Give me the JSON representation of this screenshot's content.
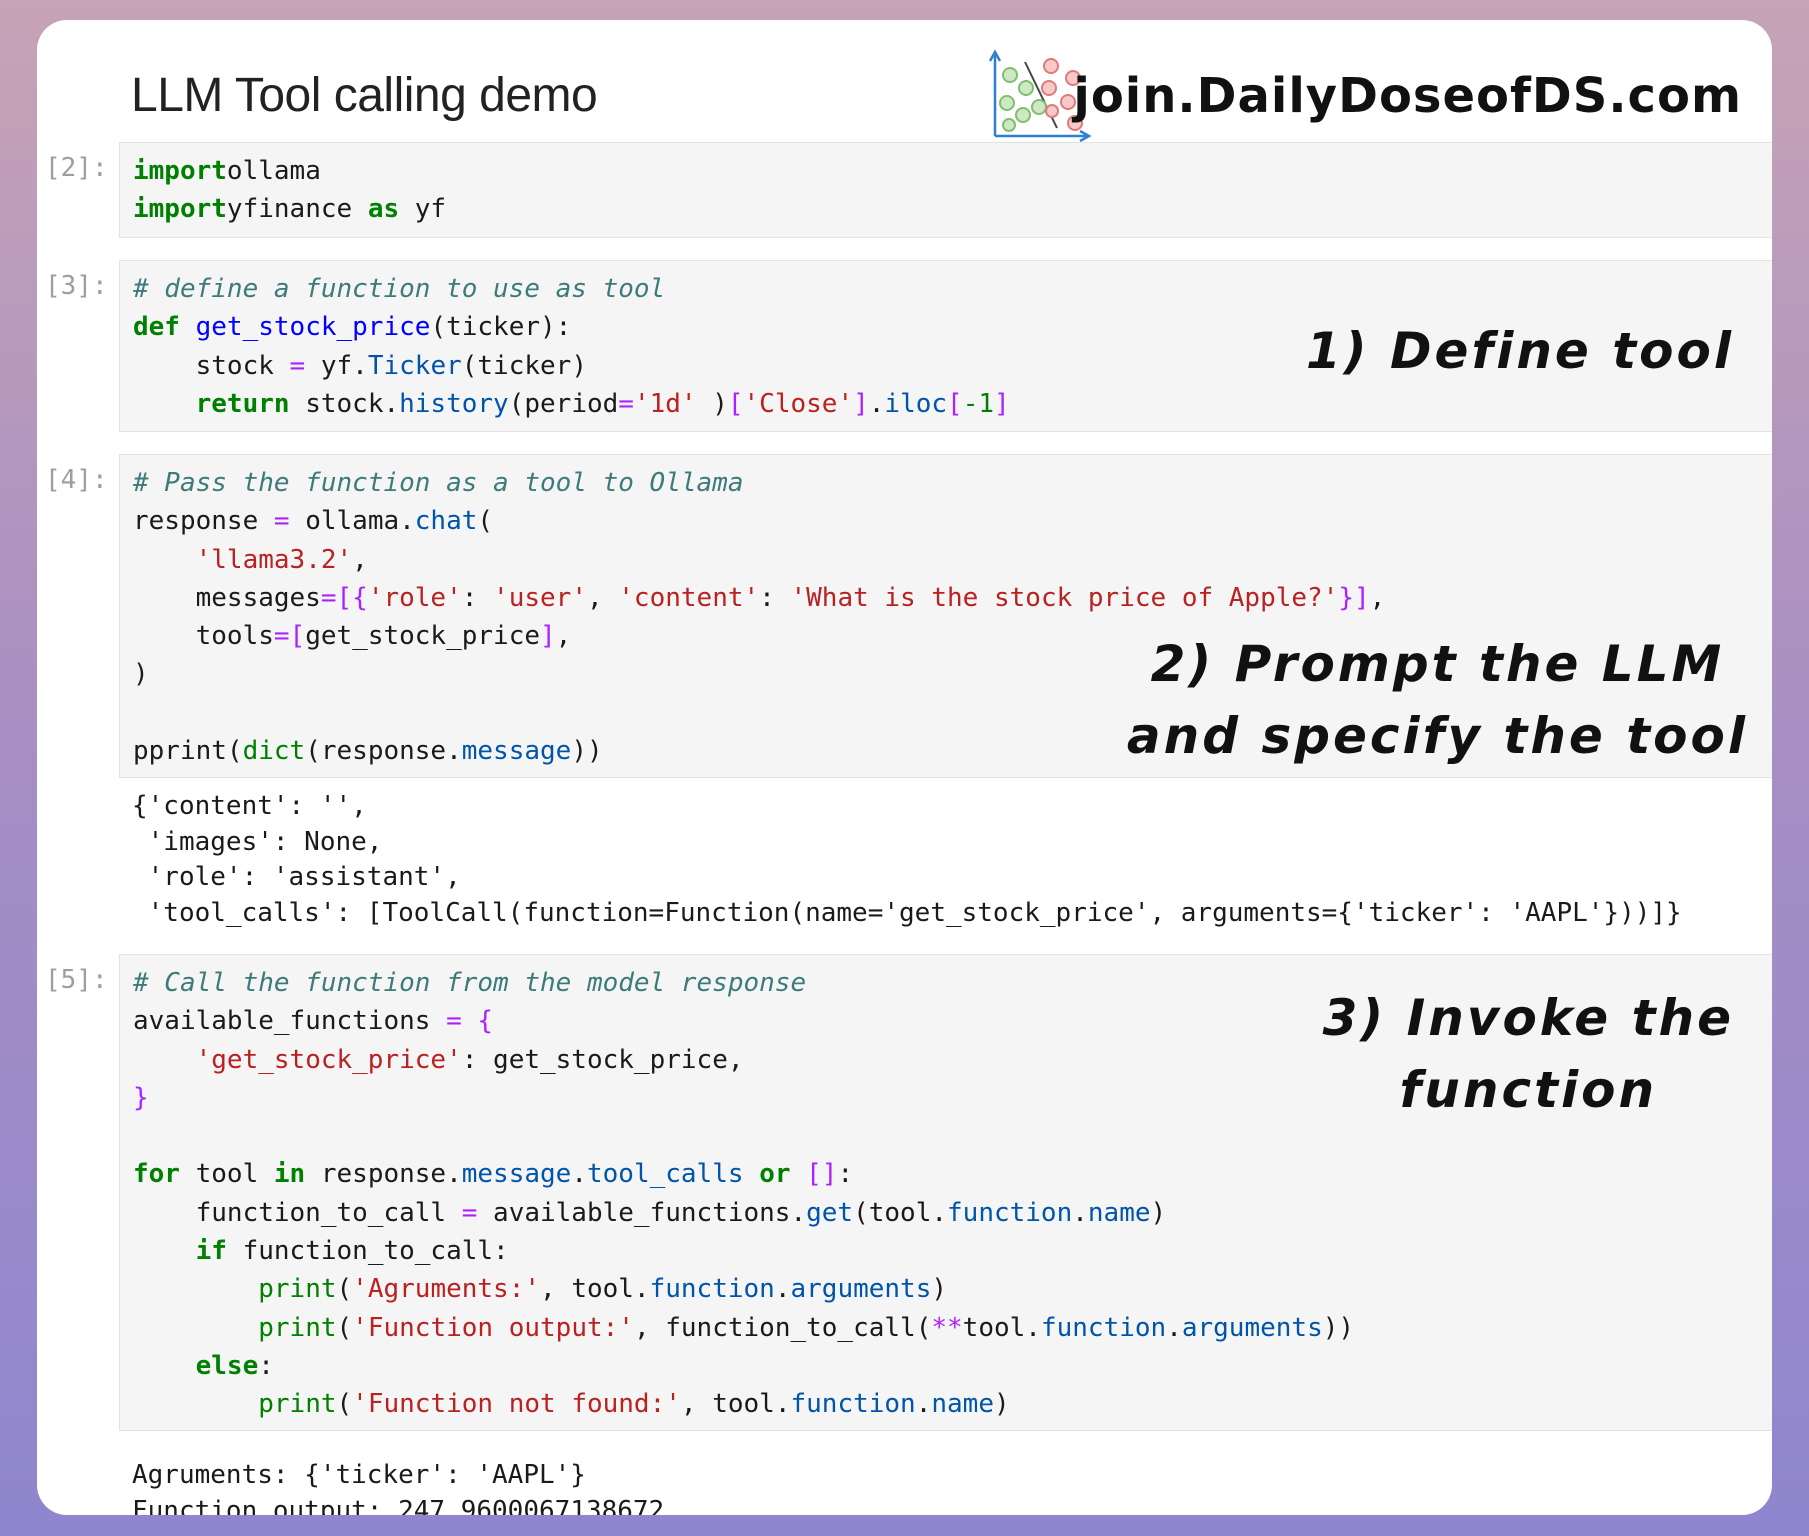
{
  "header": {
    "title": "LLM Tool calling demo",
    "brand": "join.DailyDoseofDS.com"
  },
  "cells": [
    {
      "prompt": "[2]:",
      "lines": [
        [
          [
            "k",
            "import"
          ],
          [
            "",
            "ollama"
          ]
        ],
        [
          [
            "k",
            "import"
          ],
          [
            "",
            "yfinance "
          ],
          [
            "k",
            "as"
          ],
          [
            "",
            " yf"
          ]
        ]
      ]
    },
    {
      "prompt": "[3]:",
      "lines": [
        [
          [
            "c",
            "# define a function to use as tool"
          ]
        ],
        [
          [
            "k",
            "def"
          ],
          [
            "",
            " "
          ],
          [
            "f",
            "get_stock_price"
          ],
          [
            "",
            "(ticker):"
          ]
        ],
        [
          [
            "",
            "    stock "
          ],
          [
            "o",
            "="
          ],
          [
            "",
            " yf."
          ],
          [
            "a",
            "Ticker"
          ],
          [
            "",
            "(ticker)"
          ]
        ],
        [
          [
            "",
            "    "
          ],
          [
            "k",
            "return"
          ],
          [
            "",
            " stock."
          ],
          [
            "a",
            "history"
          ],
          [
            "",
            "(period"
          ],
          [
            "o",
            "="
          ],
          [
            "s",
            "'1d'"
          ],
          [
            "",
            " )"
          ],
          [
            "o",
            "["
          ],
          [
            "s",
            "'Close'"
          ],
          [
            "o",
            "]"
          ],
          [
            "",
            "."
          ],
          [
            "a",
            "iloc"
          ],
          [
            "o",
            "["
          ],
          [
            "n",
            "-1"
          ],
          [
            "o",
            "]"
          ]
        ]
      ]
    },
    {
      "prompt": "[4]:",
      "lines": [
        [
          [
            "c",
            "# Pass the function as a tool to Ollama"
          ]
        ],
        [
          [
            "",
            "response "
          ],
          [
            "o",
            "="
          ],
          [
            "",
            " ollama."
          ],
          [
            "a",
            "chat"
          ],
          [
            "",
            "("
          ]
        ],
        [
          [
            "",
            "    "
          ],
          [
            "s",
            "'llama3.2'"
          ],
          [
            "",
            ","
          ]
        ],
        [
          [
            "",
            "    messages"
          ],
          [
            "o",
            "="
          ],
          [
            "o",
            "[{"
          ],
          [
            "s",
            "'role'"
          ],
          [
            "",
            ": "
          ],
          [
            "s",
            "'user'"
          ],
          [
            "",
            ", "
          ],
          [
            "s",
            "'content'"
          ],
          [
            "",
            ": "
          ],
          [
            "s",
            "'What is the stock price of Apple?'"
          ],
          [
            "o",
            "}]"
          ],
          [
            "",
            ","
          ]
        ],
        [
          [
            "",
            "    tools"
          ],
          [
            "o",
            "="
          ],
          [
            "o",
            "["
          ],
          [
            "",
            "get_stock_price"
          ],
          [
            "o",
            "]"
          ],
          [
            "",
            ","
          ]
        ],
        [
          [
            "",
            ")"
          ]
        ],
        [
          [
            "",
            ""
          ]
        ],
        [
          [
            "",
            "pprint("
          ],
          [
            "b",
            "dict"
          ],
          [
            "",
            "(response."
          ],
          [
            "a",
            "message"
          ],
          [
            "",
            "))"
          ]
        ]
      ],
      "output": [
        "{'content': '',",
        " 'images': None,",
        " 'role': 'assistant',",
        " 'tool_calls': [ToolCall(function=Function(name='get_stock_price', arguments={'ticker': 'AAPL'}))]}"
      ]
    },
    {
      "prompt": "[5]:",
      "lines": [
        [
          [
            "c",
            "# Call the function from the model response"
          ]
        ],
        [
          [
            "",
            "available_functions "
          ],
          [
            "o",
            "="
          ],
          [
            "",
            " "
          ],
          [
            "o",
            "{"
          ]
        ],
        [
          [
            "",
            "    "
          ],
          [
            "s",
            "'get_stock_price'"
          ],
          [
            "",
            ": get_stock_price,"
          ]
        ],
        [
          [
            "o",
            "}"
          ]
        ],
        [
          [
            "",
            ""
          ]
        ],
        [
          [
            "k",
            "for"
          ],
          [
            "",
            " tool "
          ],
          [
            "k",
            "in"
          ],
          [
            "",
            " response."
          ],
          [
            "a",
            "message"
          ],
          [
            "",
            "."
          ],
          [
            "a",
            "tool_calls"
          ],
          [
            "",
            " "
          ],
          [
            "k",
            "or"
          ],
          [
            "",
            " "
          ],
          [
            "o",
            "[]"
          ],
          [
            "",
            ":"
          ]
        ],
        [
          [
            "",
            "    function_to_call "
          ],
          [
            "o",
            "="
          ],
          [
            "",
            " available_functions."
          ],
          [
            "a",
            "get"
          ],
          [
            "",
            "(tool."
          ],
          [
            "a",
            "function"
          ],
          [
            "",
            "."
          ],
          [
            "a",
            "name"
          ],
          [
            "",
            ")"
          ]
        ],
        [
          [
            "",
            "    "
          ],
          [
            "k",
            "if"
          ],
          [
            "",
            " function_to_call:"
          ]
        ],
        [
          [
            "",
            "        "
          ],
          [
            "b",
            "print"
          ],
          [
            "",
            "("
          ],
          [
            "s",
            "'Agruments:'"
          ],
          [
            "",
            ", tool."
          ],
          [
            "a",
            "function"
          ],
          [
            "",
            "."
          ],
          [
            "a",
            "arguments"
          ],
          [
            "",
            ")"
          ]
        ],
        [
          [
            "",
            "        "
          ],
          [
            "b",
            "print"
          ],
          [
            "",
            "("
          ],
          [
            "s",
            "'Function output:'"
          ],
          [
            "",
            ", function_to_call("
          ],
          [
            "o",
            "**"
          ],
          [
            "",
            "tool."
          ],
          [
            "a",
            "function"
          ],
          [
            "",
            "."
          ],
          [
            "a",
            "arguments"
          ],
          [
            "",
            "))"
          ]
        ],
        [
          [
            "",
            "    "
          ],
          [
            "k",
            "else"
          ],
          [
            "",
            ":"
          ]
        ],
        [
          [
            "",
            "        "
          ],
          [
            "b",
            "print"
          ],
          [
            "",
            "("
          ],
          [
            "s",
            "'Function not found:'"
          ],
          [
            "",
            ", tool."
          ],
          [
            "a",
            "function"
          ],
          [
            "",
            "."
          ],
          [
            "a",
            "name"
          ],
          [
            "",
            ")"
          ]
        ]
      ],
      "output": [
        "Agruments: {'ticker': 'AAPL'}",
        "Function output: 247.9600067138672"
      ]
    }
  ],
  "annotations": {
    "step1": [
      "1) Define tool"
    ],
    "step2": [
      "2) Prompt the LLM",
      "and specify the tool"
    ],
    "step3": [
      "3) Invoke the",
      "function"
    ]
  }
}
